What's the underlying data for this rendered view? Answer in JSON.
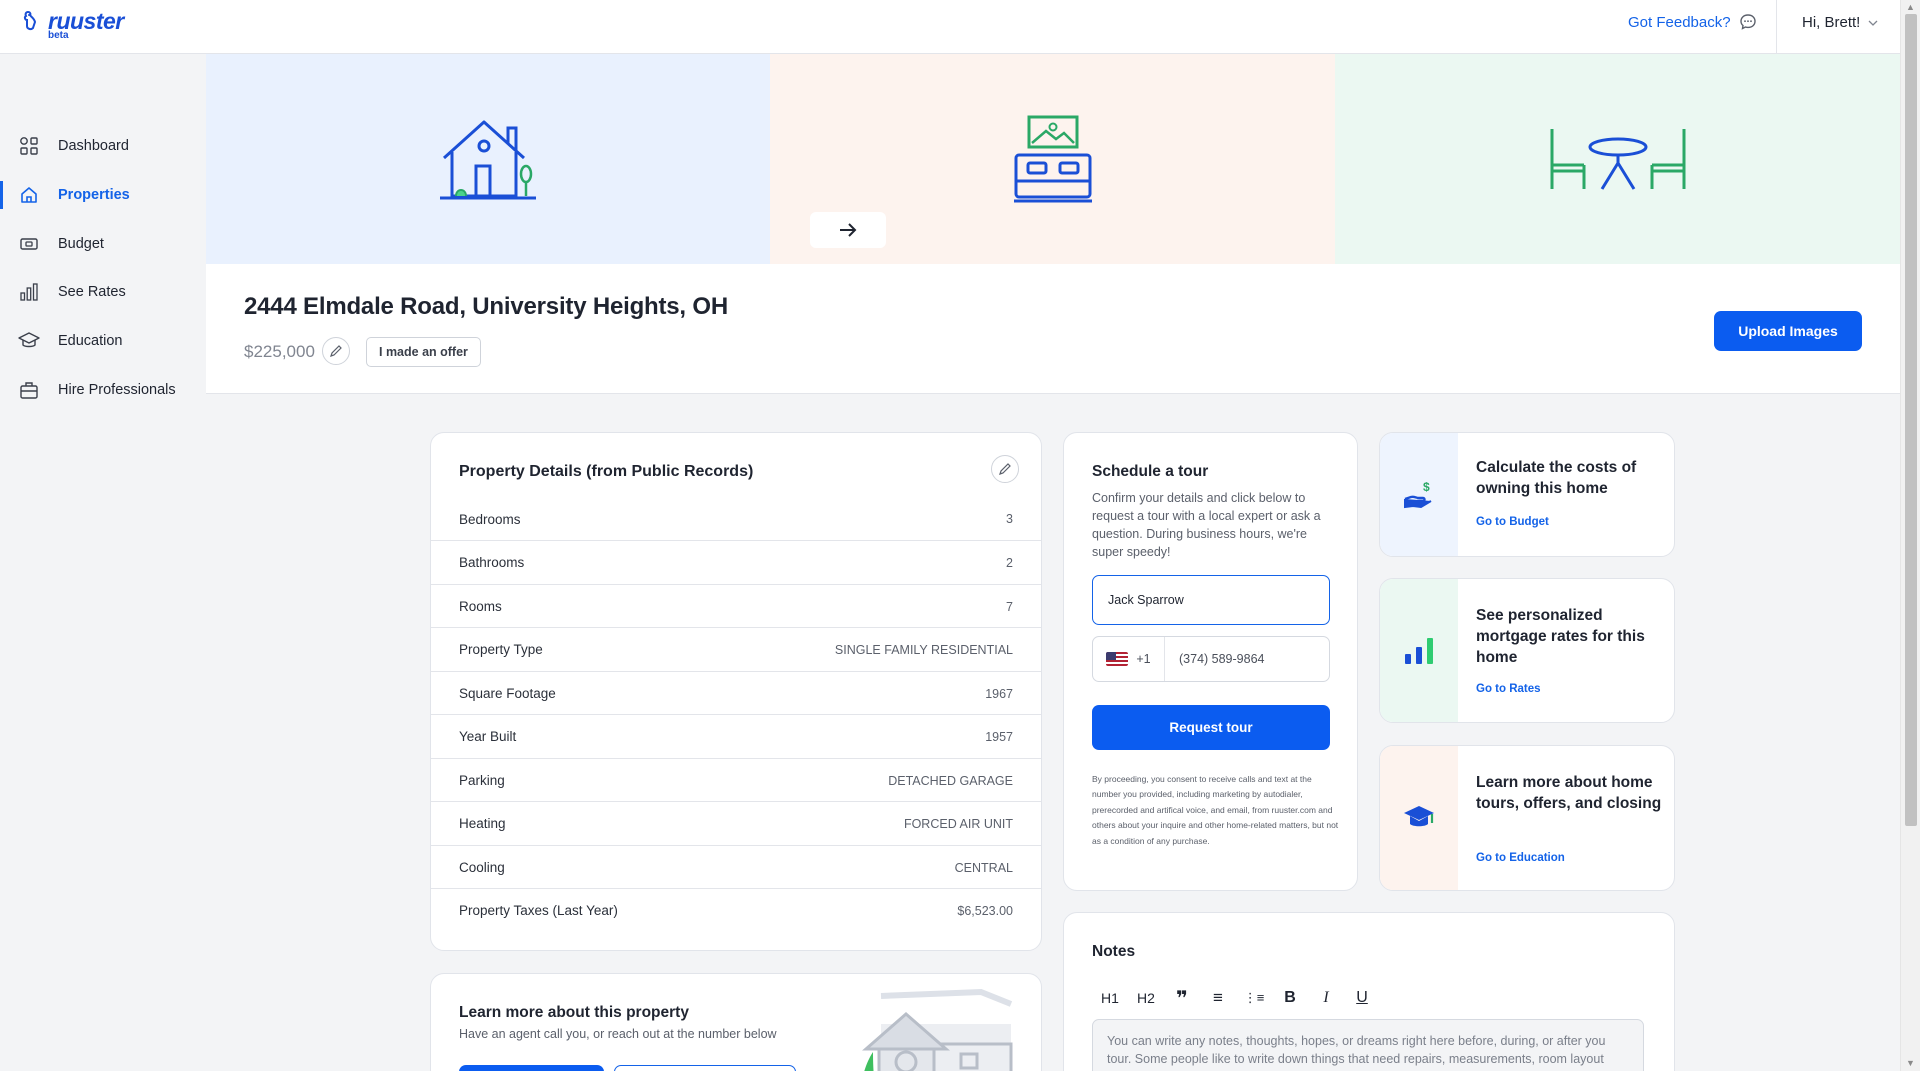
{
  "app": {
    "logo_text": "ruuster",
    "logo_badge": "beta",
    "feedback_label": "Got Feedback?",
    "user_greeting": "Hi, Brett!"
  },
  "sidebar": {
    "items": [
      {
        "label": "Dashboard",
        "icon": "grid-icon",
        "active": false
      },
      {
        "label": "Properties",
        "icon": "home-icon",
        "active": true
      },
      {
        "label": "Budget",
        "icon": "cash-icon",
        "active": false
      },
      {
        "label": "See Rates",
        "icon": "bar-chart-icon",
        "active": false
      },
      {
        "label": "Education",
        "icon": "graduation-cap-icon",
        "active": false
      },
      {
        "label": "Hire Professionals",
        "icon": "briefcase-icon",
        "active": false
      }
    ]
  },
  "hero": {
    "panels": [
      {
        "icon": "house-illustration-icon",
        "bg": "#e9f1fe"
      },
      {
        "icon": "bed-illustration-icon",
        "bg": "#fdf3ee"
      },
      {
        "icon": "table-chairs-illustration-icon",
        "bg": "#ebf8f2"
      }
    ]
  },
  "property": {
    "address": "2444 Elmdale Road, University Heights, OH",
    "price": "$225,000",
    "offer_label": "I made an offer",
    "upload_label": "Upload Images"
  },
  "details": {
    "title": "Property Details (from Public Records)",
    "rows": [
      {
        "label": "Bedrooms",
        "value": "3"
      },
      {
        "label": "Bathrooms",
        "value": "2"
      },
      {
        "label": "Rooms",
        "value": "7"
      },
      {
        "label": "Property Type",
        "value": "SINGLE FAMILY RESIDENTIAL"
      },
      {
        "label": "Square Footage",
        "value": "1967"
      },
      {
        "label": "Year Built",
        "value": "1957"
      },
      {
        "label": "Parking",
        "value": "DETACHED GARAGE"
      },
      {
        "label": "Heating",
        "value": "FORCED AIR UNIT"
      },
      {
        "label": "Cooling",
        "value": "CENTRAL"
      },
      {
        "label": "Property Taxes (Last Year)",
        "value": "$6,523.00"
      }
    ]
  },
  "tour": {
    "title": "Schedule a tour",
    "description": "Confirm your details and click below to request a tour with a local expert or ask a question. During business hours, we're super speedy!",
    "name_value": "Jack Sparrow",
    "country_code": "+1",
    "phone_value": "(374) 589-9864",
    "button_label": "Request tour",
    "consent": "By proceeding, you consent to receive calls and text at the number you provided, including marketing by autodialer, prerecorded and artifical voice, and email, from ruuster.com and others about your inquire and other home-related matters, but not as a condition of any purchase."
  },
  "ctas": [
    {
      "title": "Calculate the costs of owning this home",
      "link": "Go to Budget",
      "icon": "money-hand-icon",
      "bg": "#eef4fe"
    },
    {
      "title": "See personalized mortgage rates for this home",
      "link": "Go to Rates",
      "icon": "bar-chart-icon",
      "bg": "#ebf8f2"
    },
    {
      "title": "Learn more about home tours, offers, and closing",
      "link": "Go to Education",
      "icon": "graduation-cap-icon",
      "bg": "#fdf3ee"
    }
  ],
  "notes": {
    "title": "Notes",
    "toolbar": [
      "H1",
      "H2",
      "❞",
      "≡",
      "⋮≡",
      "B",
      "I",
      "U"
    ],
    "placeholder": "You can write any notes, thoughts, hopes, or dreams right here before, during, or after you tour. Some people like to write down things that need repairs, measurements, room layout"
  },
  "learn": {
    "title": "Learn more about this property",
    "subtitle": "Have an agent call you, or reach out at the number below"
  },
  "colors": {
    "primary": "#0b5cf0",
    "link": "#1463e8",
    "accent_green": "#2ecc71"
  }
}
